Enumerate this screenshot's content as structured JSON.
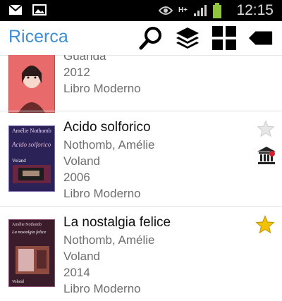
{
  "app": {
    "title": "Ricerca"
  },
  "status": {
    "time": "12:15",
    "network": "H+"
  },
  "icons": {
    "search": "search-icon",
    "layers": "layers-icon",
    "grid": "grid-icon",
    "tag": "tag-icon"
  },
  "colors": {
    "accent": "#3b8fd6",
    "star": "#f2c200",
    "star_off": "#d9d9d9",
    "library": "#222222"
  },
  "items": [
    {
      "title": "",
      "author": "",
      "publisher": "Guanda",
      "year": "2012",
      "type": "Libro Moderno",
      "favorite": false
    },
    {
      "title": "Acido solforico",
      "author": "Nothomb, Amélie",
      "publisher": "Voland",
      "year": "2006",
      "type": "Libro Moderno",
      "favorite": false,
      "cover_author": "Amélie Nothomb",
      "cover_title": "Acido solforico",
      "cover_publisher": "Voland"
    },
    {
      "title": "La nostalgia felice",
      "author": "Nothomb, Amélie",
      "publisher": "Voland",
      "year": "2014",
      "type": "Libro Moderno",
      "favorite": true,
      "cover_author": "Amélie Nothomb",
      "cover_title": "La nostalgia felice",
      "cover_publisher": "Voland"
    }
  ]
}
